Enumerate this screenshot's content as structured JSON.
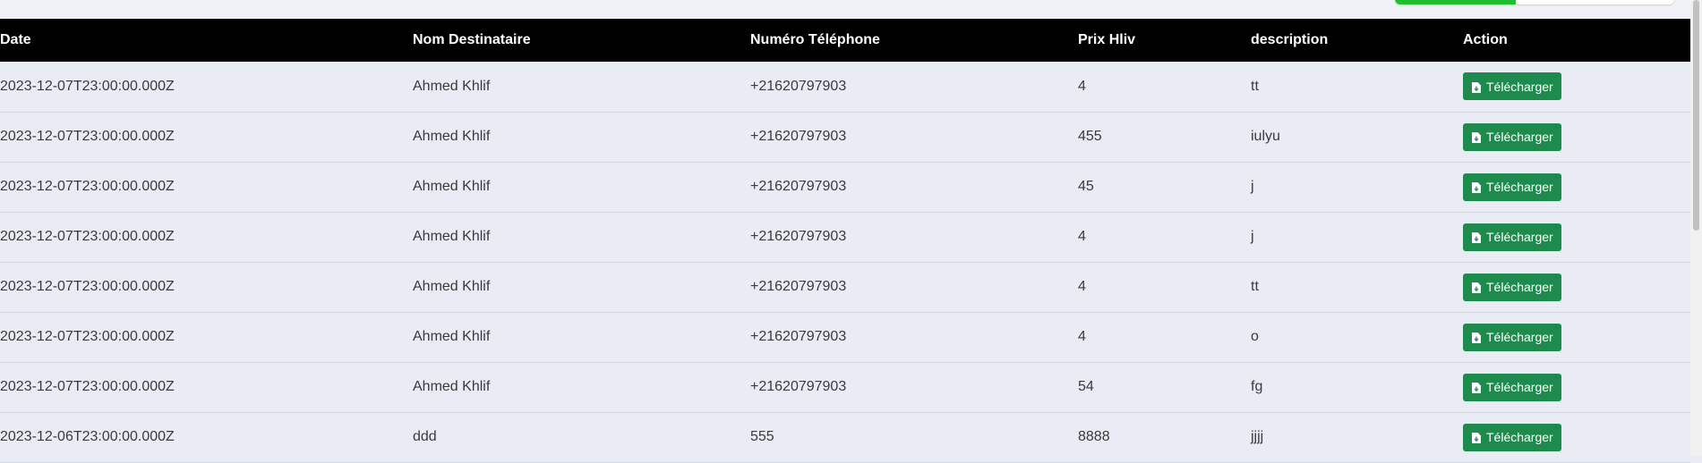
{
  "table": {
    "headers": [
      "Date",
      "Nom Destinataire",
      "Numéro Téléphone",
      "Prix Hliv",
      "description",
      "Action"
    ],
    "rows": [
      {
        "date": "2023-12-07T23:00:00.000Z",
        "nom": "Ahmed Khlif",
        "tel": "+21620797903",
        "prix": "4",
        "description": "tt"
      },
      {
        "date": "2023-12-07T23:00:00.000Z",
        "nom": "Ahmed Khlif",
        "tel": "+21620797903",
        "prix": "455",
        "description": "iulyu"
      },
      {
        "date": "2023-12-07T23:00:00.000Z",
        "nom": "Ahmed Khlif",
        "tel": "+21620797903",
        "prix": "45",
        "description": "j"
      },
      {
        "date": "2023-12-07T23:00:00.000Z",
        "nom": "Ahmed Khlif",
        "tel": "+21620797903",
        "prix": "4",
        "description": "j"
      },
      {
        "date": "2023-12-07T23:00:00.000Z",
        "nom": "Ahmed Khlif",
        "tel": "+21620797903",
        "prix": "4",
        "description": "tt"
      },
      {
        "date": "2023-12-07T23:00:00.000Z",
        "nom": "Ahmed Khlif",
        "tel": "+21620797903",
        "prix": "4",
        "description": "o"
      },
      {
        "date": "2023-12-07T23:00:00.000Z",
        "nom": "Ahmed Khlif",
        "tel": "+21620797903",
        "prix": "54",
        "description": "fg"
      },
      {
        "date": "2023-12-06T23:00:00.000Z",
        "nom": "ddd",
        "tel": "555",
        "prix": "8888",
        "description": "jjjj"
      }
    ],
    "action_label": "Télécharger",
    "action_icon": "file-download-icon"
  },
  "colors": {
    "page_background": "#e9ecf5",
    "header_background": "#000000",
    "button_green": "#1e8a4d",
    "top_accent": "#1fbd2f"
  }
}
